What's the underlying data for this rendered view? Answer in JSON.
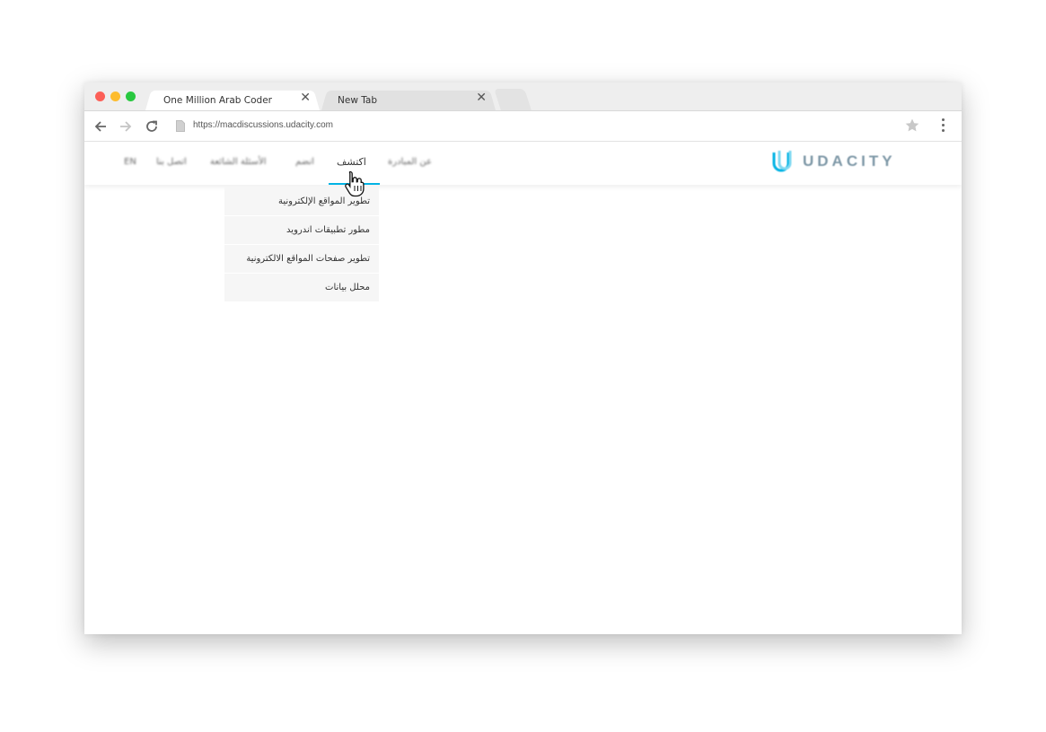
{
  "browser": {
    "tabs": [
      {
        "title": "One Million Arab Coder",
        "close": "✕",
        "active": true
      },
      {
        "title": "New Tab",
        "close": "✕",
        "active": false
      }
    ],
    "url": "https://macdiscussions.udacity.com",
    "icons": [
      "back-arrow-icon",
      "forward-arrow-icon",
      "reload-icon",
      "page-icon",
      "star-icon",
      "menu-dots-icon"
    ]
  },
  "site": {
    "logo_text": "UDACITY",
    "nav": {
      "en": "EN",
      "contact": "اتصل بنا",
      "faq": "الأسئلة الشائعة",
      "join": "انضم",
      "discover": "اكتشف",
      "about": "عن المبادرة"
    },
    "dropdown": [
      "تطوير المواقع الإلكترونية",
      "مطور تطبيقات اندرويد",
      "تطوير صفحات المواقع الالكترونية",
      "محلل بيانات"
    ],
    "accent_color": "#02b3e4"
  }
}
